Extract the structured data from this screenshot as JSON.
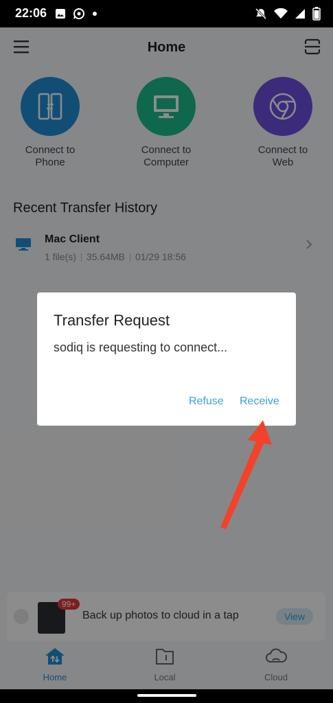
{
  "status_bar": {
    "time": "22:06",
    "battery": "73"
  },
  "header": {
    "title": "Home"
  },
  "connect": [
    {
      "label_line1": "Connect to",
      "label_line2": "Phone"
    },
    {
      "label_line1": "Connect to",
      "label_line2": "Computer"
    },
    {
      "label_line1": "Connect to",
      "label_line2": "Web"
    }
  ],
  "recent": {
    "title": "Recent Transfer History",
    "items": [
      {
        "name": "Mac Client",
        "files": "1 file(s)",
        "size": "35.64MB",
        "date": "01/29 18:56"
      }
    ]
  },
  "banner": {
    "badge": "99+",
    "text": "Back up photos to cloud in a tap",
    "view_label": "View"
  },
  "nav": {
    "home": "Home",
    "local": "Local",
    "cloud": "Cloud"
  },
  "dialog": {
    "title": "Transfer Request",
    "message": "sodiq is requesting to connect...",
    "refuse": "Refuse",
    "receive": "Receive"
  },
  "colors": {
    "accent": "#3b9ee0",
    "arrow": "#f4412a"
  }
}
